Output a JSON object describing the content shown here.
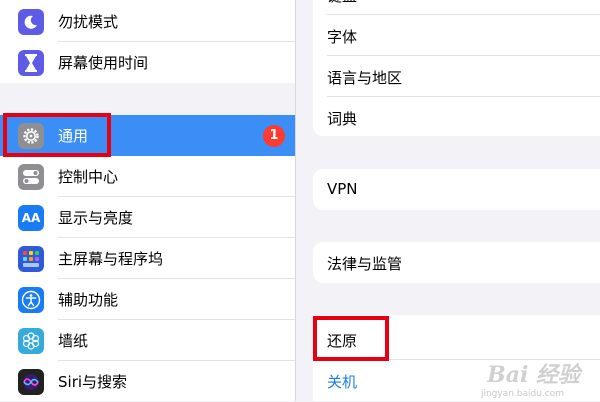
{
  "sidebar": {
    "items": [
      {
        "label": "勿扰模式",
        "icon": "moon-icon",
        "color": "#5e5ce6"
      },
      {
        "label": "屏幕使用时间",
        "icon": "hourglass-icon",
        "color": "#5e5ce6"
      },
      {
        "label": "通用",
        "icon": "gear-icon",
        "color": "#8e8e93",
        "badge": "1"
      },
      {
        "label": "控制中心",
        "icon": "switches-icon",
        "color": "#8e8e93"
      },
      {
        "label": "显示与亮度",
        "icon": "text-size-icon",
        "color": "#1a7cf5"
      },
      {
        "label": "主屏幕与程序坞",
        "icon": "home-grid-icon",
        "color": "#2f5bd8"
      },
      {
        "label": "辅助功能",
        "icon": "accessibility-icon",
        "color": "#1a7cf5"
      },
      {
        "label": "墙纸",
        "icon": "flower-icon",
        "color": "#35aadc"
      },
      {
        "label": "Siri与搜索",
        "icon": "siri-icon",
        "color": "#222222"
      }
    ],
    "selected_color": "#3b8ef5"
  },
  "main": {
    "groups": [
      [
        "键盘",
        "字体",
        "语言与地区",
        "词典"
      ],
      [
        "VPN"
      ],
      [
        "法律与监管"
      ],
      [
        "还原",
        "关机"
      ]
    ]
  },
  "highlight_color": "#e60012",
  "watermark": {
    "text": "Bai 经验",
    "sub": "jingyan.baidu.com"
  }
}
